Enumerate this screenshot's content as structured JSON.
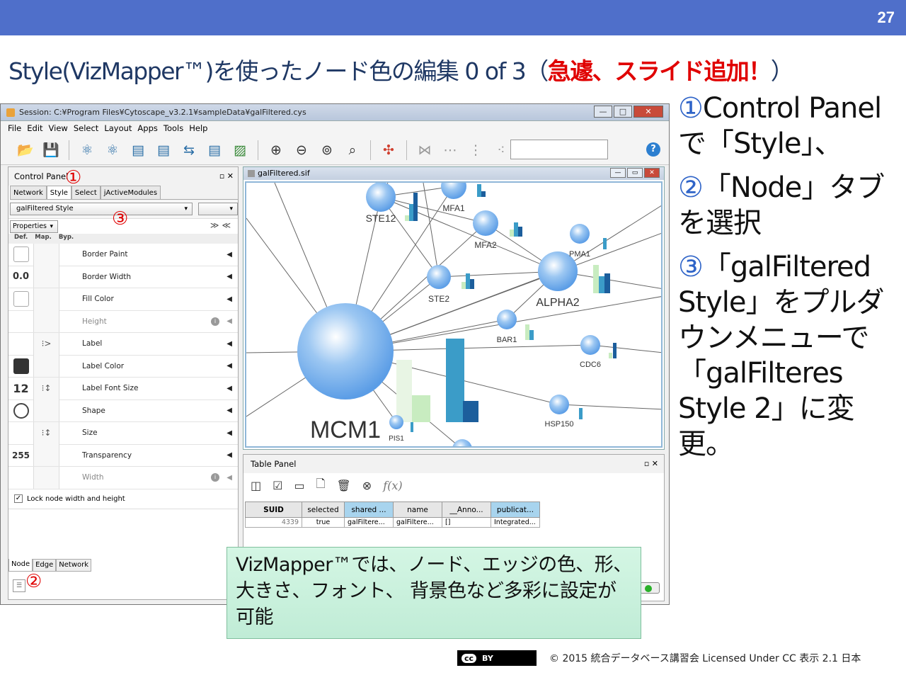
{
  "slide": {
    "page_number": "27",
    "title_main": "Style(VizMapper™)を使ったノード色の編集 0 of 3（",
    "title_red": "急遽、スライド追加！",
    "title_end": "）",
    "marker1": "①",
    "marker2": "②",
    "marker3": "③",
    "steps": [
      {
        "num": "①",
        "text": "Control Panelで「Style」、"
      },
      {
        "num": "②",
        "text": "「Node」タブを選択"
      },
      {
        "num": "③",
        "text": "「galFiltered Style」をプルダウンメニューで「galFilteres Style 2」に変更。"
      }
    ],
    "note": "VizMapper™では、ノード、エッジの色、形、大きさ、フォント、 背景色など多彩に設定が可能",
    "cc_label": "cc",
    "cc_by": "BY",
    "copyright": "© 2015  統合データベース講習会 Licensed Under CC 表示 2.1 日本"
  },
  "window": {
    "title": "Session: C:¥Program Files¥Cytoscape_v3.2.1¥sampleData¥galFiltered.cys",
    "minimize": "—",
    "maximize": "□",
    "close": "✕",
    "menu": [
      "File",
      "Edit",
      "View",
      "Select",
      "Layout",
      "Apps",
      "Tools",
      "Help"
    ],
    "help_icon": "?"
  },
  "toolbar": {
    "icons": [
      "open-folder-icon",
      "save-icon",
      "import-network-icon",
      "import-network-url-icon",
      "import-table-icon",
      "import-table-url-icon",
      "export-network-icon",
      "export-table-icon",
      "export-image-icon",
      "zoom-in-icon",
      "zoom-out-icon",
      "zoom-fit-icon",
      "zoom-selected-icon",
      "layout-icon",
      "hide-selected-icon",
      "show-all-icon",
      "first-neighbors-icon",
      "select-nodes-icon"
    ],
    "glyphs": [
      "📂",
      "💾",
      "⚛",
      "⚛",
      "▤",
      "▤",
      "⇆",
      "▤",
      "▨",
      "⊕",
      "⊖",
      "⊚",
      "⌕",
      "✣",
      "⋈",
      "⋯",
      "⋮",
      "⁖"
    ]
  },
  "control_panel": {
    "title": "Control Panel",
    "controls": "▫ ✕",
    "tabs": [
      "Network",
      "Style",
      "Select",
      "jActiveModules"
    ],
    "style_selected": "galFiltered Style",
    "style_options_button": "",
    "properties_label": "Properties",
    "collapse_chevrons": "≫≪",
    "columns": [
      "Def.",
      "Map.",
      "Byp."
    ],
    "properties": [
      {
        "def": "",
        "map": "",
        "name": "Border Paint",
        "dim": false
      },
      {
        "def": "0.0",
        "map": "",
        "name": "Border Width",
        "dim": false
      },
      {
        "def": "",
        "map": "",
        "name": "Fill Color",
        "dim": false
      },
      {
        "def": "",
        "map": "",
        "name": "Height",
        "dim": true
      },
      {
        "def": "",
        "map": "⁝>",
        "name": "Label",
        "dim": false
      },
      {
        "def": "",
        "map": "",
        "name": "Label Color",
        "dim": false
      },
      {
        "def": "12",
        "map": "⁝↕",
        "name": "Label Font Size",
        "dim": false
      },
      {
        "def": "",
        "map": "",
        "name": "Shape",
        "dim": false
      },
      {
        "def": "",
        "map": "⁝↕",
        "name": "Size",
        "dim": false
      },
      {
        "def": "255",
        "map": "",
        "name": "Transparency",
        "dim": false
      },
      {
        "def": "",
        "map": "",
        "name": "Width",
        "dim": true
      }
    ],
    "lock_label": "Lock node width and height",
    "lock_checked": "✓",
    "bottom_tabs": [
      "Node",
      "Edge",
      "Network"
    ]
  },
  "network_view": {
    "title": "galFiltered.sif",
    "nodes": [
      "MCM1",
      "STE12",
      "MFA1",
      "MFA2",
      "PMA1",
      "ALPHA2",
      "STE2",
      "BAR1",
      "CDC6",
      "HSP150",
      "PIS1"
    ]
  },
  "table_panel": {
    "title": "Table Panel",
    "controls": "▫ ✕",
    "tool_glyphs": [
      "◫",
      "☑",
      "▭",
      "🗋",
      "🗑",
      "⊗",
      "f(x)"
    ],
    "columns": [
      "SUID",
      "selected",
      "shared ...",
      "name",
      "__Anno...",
      "publicat..."
    ],
    "row": [
      "4339",
      "true",
      "galFiltere...",
      "galFiltere...",
      "[]",
      "Integrated..."
    ]
  },
  "colors": {
    "header_bar": "#4f6fca",
    "title_text": "#1f3864",
    "emphasis_red": "#e00000",
    "step_number_blue": "#2f64c8",
    "note_bg": "#c8f0dc",
    "node_blue": "#5b9de6"
  }
}
